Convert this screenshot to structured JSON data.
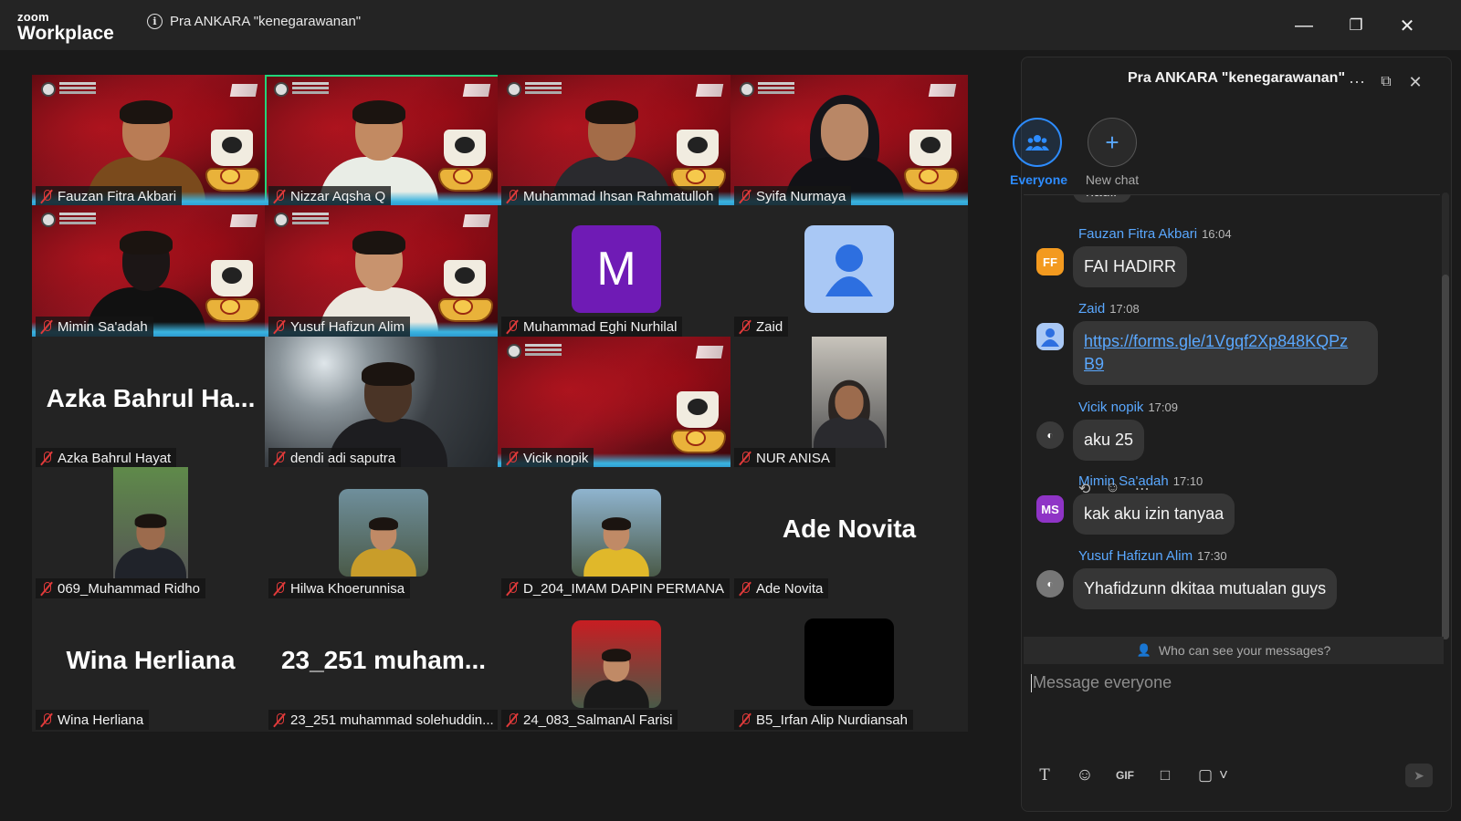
{
  "app": {
    "brand_small": "zoom",
    "brand_big": "Workplace",
    "meeting_title": "Pra ANKARA \"kenegarawanan\""
  },
  "window": {
    "minimize": "—",
    "restore": "❐",
    "close": "✕"
  },
  "participants": [
    {
      "name": "Fauzan Fitra Akbari",
      "kind": "video"
    },
    {
      "name": "Nizzar Aqsha Q",
      "kind": "video",
      "active": true
    },
    {
      "name": "Muhammad Ihsan Rahmatulloh",
      "kind": "video"
    },
    {
      "name": "Syifa Nurmaya",
      "kind": "video"
    },
    {
      "name": "Mimin Sa'adah",
      "kind": "video"
    },
    {
      "name": "Yusuf Hafizun Alim",
      "kind": "video"
    },
    {
      "name": "Muhammad Eghi Nurhilal",
      "kind": "avatar",
      "letter": "M"
    },
    {
      "name": "Zaid",
      "kind": "avatar-default"
    },
    {
      "name": "Azka Bahrul Hayat",
      "kind": "text",
      "big": "Azka Bahrul Ha..."
    },
    {
      "name": "dendi adi saputra",
      "kind": "camera"
    },
    {
      "name": "Vicik nopik",
      "kind": "video"
    },
    {
      "name": "NUR ANISA",
      "kind": "photo"
    },
    {
      "name": "069_Muhammad Ridho",
      "kind": "photo"
    },
    {
      "name": "Hilwa Khoerunnisa",
      "kind": "photo"
    },
    {
      "name": "D_204_IMAM DAPIN PERMANA",
      "kind": "photo"
    },
    {
      "name": "Ade Novita",
      "kind": "text",
      "big": "Ade Novita"
    },
    {
      "name": "Wina Herliana",
      "kind": "text",
      "big": "Wina Herliana"
    },
    {
      "name": "23_251 muhammad solehuddin...",
      "kind": "text",
      "big": "23_251  muham..."
    },
    {
      "name": "24_083_SalmanAl Farisi",
      "kind": "photo"
    },
    {
      "name": "B5_Irfan Alip Nurdiansah",
      "kind": "black"
    }
  ],
  "chat": {
    "title": "Pra ANKARA \"kenegarawanan\"",
    "tabs": [
      {
        "label": "Everyone"
      },
      {
        "label": "New chat"
      }
    ],
    "messages": [
      {
        "sender": "Fauzan Fitra Akbari",
        "time": "16:04",
        "initials": "FF",
        "text": "FAI HADIRR"
      },
      {
        "sender": "Zaid",
        "time": "17:08",
        "initials": "",
        "text": "https://forms.gle/1Vgqf2Xp848KQPzB9",
        "link_line1": "https://forms.gle/1Vgqf2Xp848KQPz",
        "link_line2": "B9"
      },
      {
        "sender": "Vicik nopik",
        "time": "17:09",
        "initials": "",
        "text": "aku 25"
      },
      {
        "sender": "Mimin Sa'adah",
        "time": "17:10",
        "initials": "MS",
        "text": "kak aku izin tanyaa"
      },
      {
        "sender": "Yusuf Hafizun Alim",
        "time": "17:30",
        "initials": "",
        "text": "Yhafidzunn dkitaa mutualan guys"
      }
    ],
    "partial_message": "hadir",
    "who_can_see": "Who can see your messages?",
    "composer_placeholder": "Message everyone",
    "toolbar": {
      "format": "T",
      "emoji": "☺",
      "gif": "GIF",
      "file": "□",
      "screenshot": "▢",
      "more": "˅"
    }
  },
  "colors": {
    "active_border": "#22d47a",
    "accent_blue": "#2d8cff",
    "link_blue": "#5aa8ff",
    "muted_red": "#e03a3a",
    "avatar_purple": "#6f1bb5",
    "ff_orange": "#f39a1f",
    "ms_purple": "#8f34c6"
  }
}
